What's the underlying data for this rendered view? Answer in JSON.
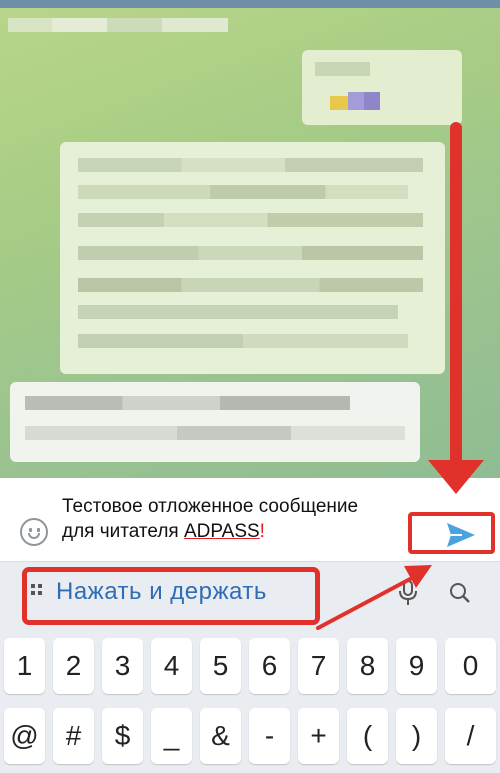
{
  "chat": {
    "note": ""
  },
  "composer": {
    "message_line1": "Тестовое отложенное сообщение",
    "message_line2_prefix": "для читателя ",
    "message_line2_brand": "ADPASS",
    "message_line2_suffix": "!",
    "send_icon": "send-arrow-icon",
    "emoji_icon": "smile-icon",
    "accent_color": "#4aa3df"
  },
  "keyboard": {
    "suggestion": "Нажать и держать",
    "suggestion_color": "#2f6db5",
    "grid_icon": "grid-icon",
    "mic_icon": "mic-icon",
    "search_icon": "search-icon",
    "row1": [
      "1",
      "2",
      "3",
      "4",
      "5",
      "6",
      "7",
      "8",
      "9",
      "0"
    ],
    "row2": [
      "@",
      "#",
      "$",
      "_",
      "&",
      "-",
      "+",
      "(",
      ")",
      "/"
    ]
  },
  "annotations": {
    "highlight_color": "#e0312b"
  }
}
